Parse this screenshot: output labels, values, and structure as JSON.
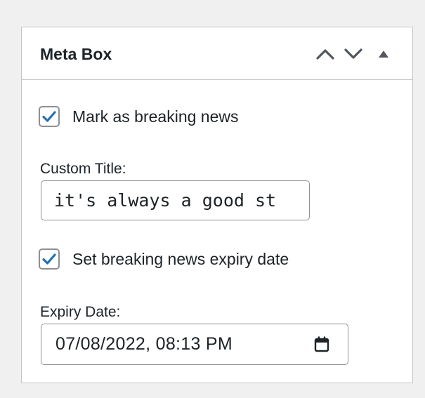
{
  "metabox": {
    "title": "Meta Box",
    "controls": {
      "move_up": "chevron-up-icon",
      "move_down": "chevron-down-icon",
      "toggle_panel": "triangle-up-icon"
    }
  },
  "fields": {
    "breaking_news": {
      "label": "Mark as breaking news",
      "checked": true
    },
    "custom_title": {
      "label": "Custom Title:",
      "value": "it's always a good st"
    },
    "expiry_toggle": {
      "label": "Set breaking news expiry date",
      "checked": true
    },
    "expiry_date": {
      "label": "Expiry Date:",
      "value": "07/08/2022, 08:13 PM",
      "icon": "calendar-icon"
    }
  },
  "colors": {
    "background": "#f0f0f1",
    "panel": "#ffffff",
    "border": "#c3c4c7",
    "accent": "#2271b1",
    "text": "#1d2327",
    "icon": "#50575e"
  }
}
